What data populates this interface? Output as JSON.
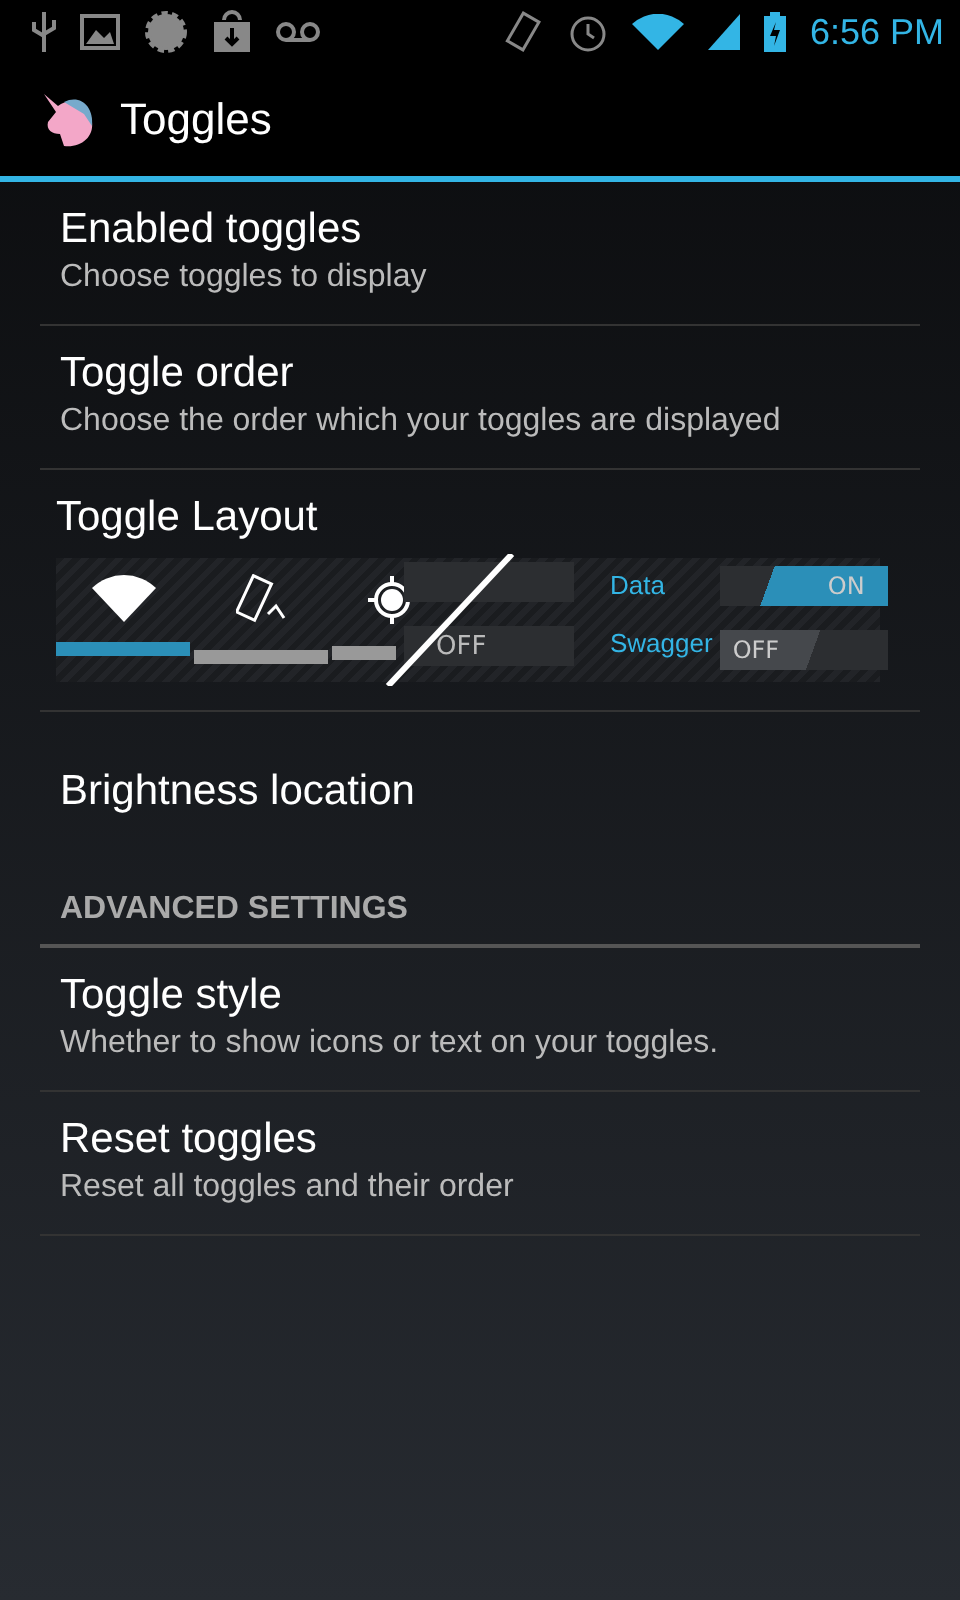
{
  "status_bar": {
    "time": "6:56 PM"
  },
  "action_bar": {
    "title": "Toggles"
  },
  "preferences": [
    {
      "kind": "pref",
      "title": "Enabled toggles",
      "summary": "Choose toggles to display"
    },
    {
      "kind": "pref",
      "title": "Toggle order",
      "summary": "Choose the order which your toggles are displayed"
    },
    {
      "kind": "preview",
      "title": "Toggle Layout",
      "tiles": [
        {
          "kind": "wifi",
          "on": true
        },
        {
          "kind": "rotate",
          "on": false
        },
        {
          "kind": "gps",
          "on": false
        }
      ],
      "partial_switches": [
        {
          "on": false
        },
        {
          "on": false,
          "state": "OFF"
        }
      ],
      "switches": [
        {
          "label": "Data",
          "on": true,
          "state": "ON"
        },
        {
          "label": "Swagger",
          "on": false,
          "state": "OFF"
        }
      ]
    },
    {
      "kind": "pref",
      "title": "Brightness location"
    },
    {
      "kind": "category",
      "title": "ADVANCED SETTINGS"
    },
    {
      "kind": "pref",
      "title": "Toggle style",
      "summary": "Whether to show icons or text on your toggles."
    },
    {
      "kind": "pref",
      "title": "Reset toggles",
      "summary": "Reset all toggles and their order"
    }
  ]
}
